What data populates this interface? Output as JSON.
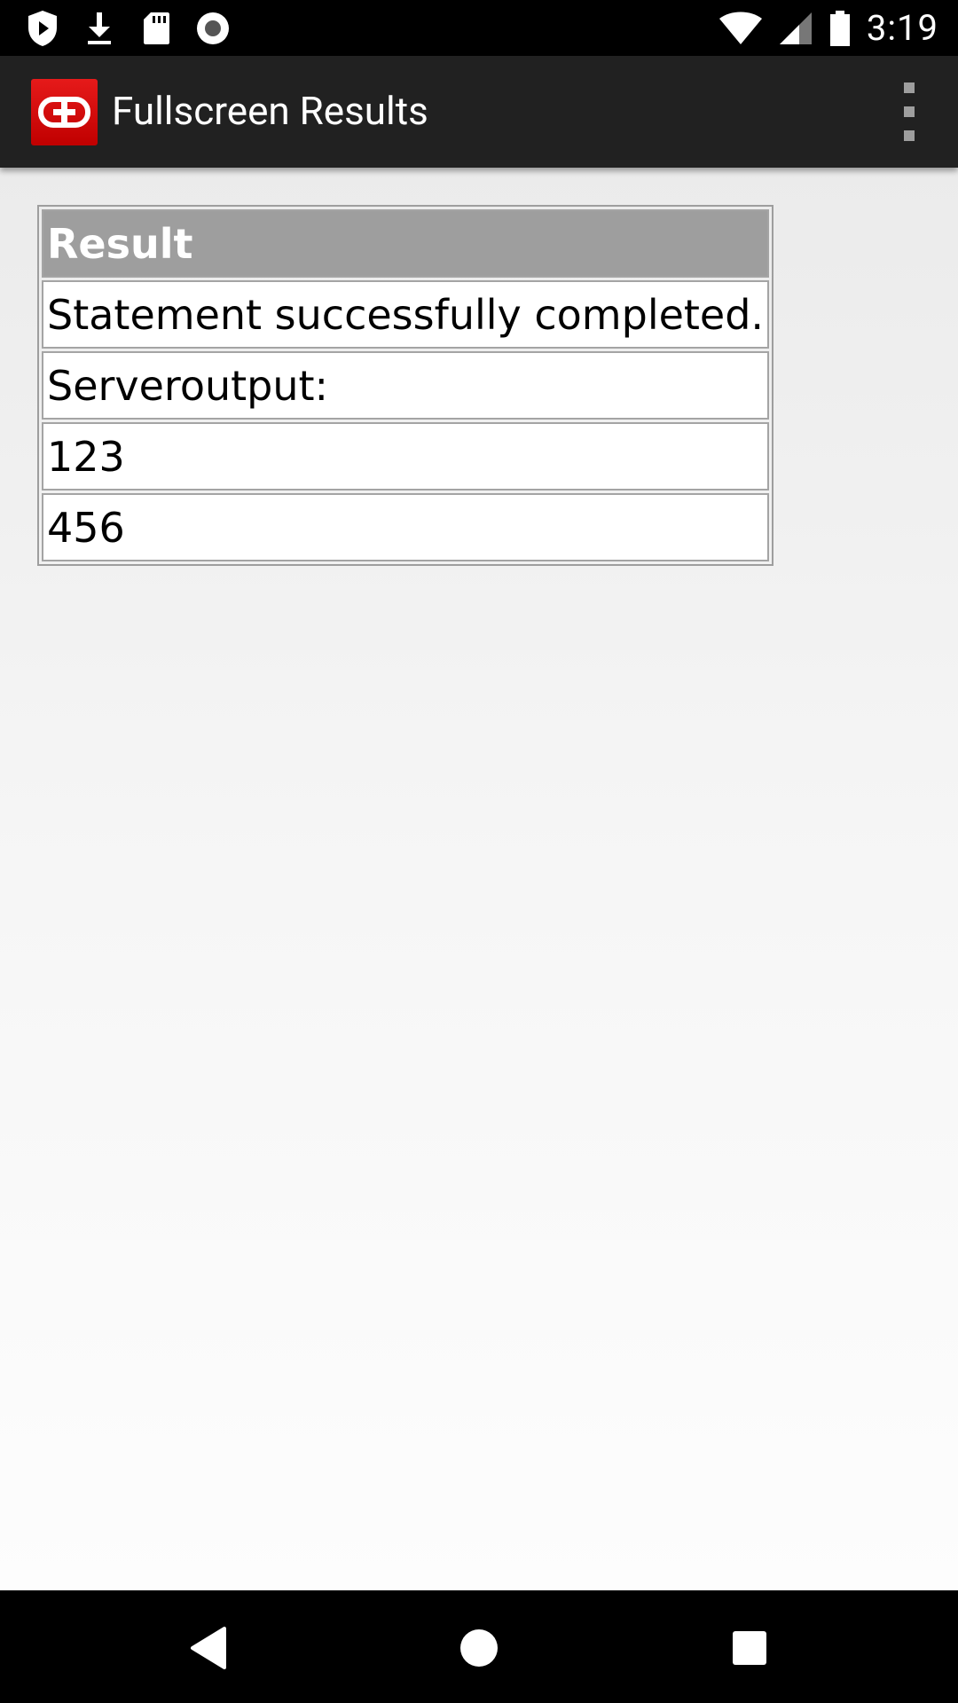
{
  "status_bar": {
    "time": "3:19",
    "left_icons": [
      "play-protect-icon",
      "download-icon",
      "sd-card-icon",
      "record-icon"
    ],
    "right_icons": [
      "wifi-icon",
      "signal-icon",
      "battery-icon"
    ]
  },
  "app_bar": {
    "title": "Fullscreen Results",
    "logo_icon": "app-logo-icon",
    "menu_icon": "overflow-menu-icon"
  },
  "results_table": {
    "header": "Result",
    "rows": [
      "Statement successfully completed.",
      "Serveroutput:",
      "123",
      "456"
    ]
  },
  "nav_bar": {
    "icons": [
      "back-icon",
      "home-icon",
      "recents-icon"
    ]
  },
  "colors": {
    "app_bar_bg": "#212121",
    "logo_red": "#d50000",
    "header_cell_bg": "#9e9e9e"
  }
}
